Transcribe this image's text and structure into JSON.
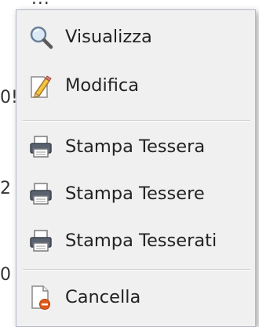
{
  "background": {
    "top_fragment": "¹...",
    "row_fragments": [
      "0!",
      "2",
      "0"
    ]
  },
  "context_menu": {
    "items": [
      {
        "label": "Visualizza",
        "icon": "magnifier-icon"
      },
      {
        "label": "Modifica",
        "icon": "pencil-edit-icon"
      },
      {
        "label": "Stampa Tessera",
        "icon": "printer-icon"
      },
      {
        "label": "Stampa Tessere",
        "icon": "printer-icon"
      },
      {
        "label": "Stampa Tesserati",
        "icon": "printer-icon"
      },
      {
        "label": "Cancella",
        "icon": "delete-document-icon"
      }
    ]
  },
  "colors": {
    "menu_bg": "#f0f0f0",
    "menu_border": "#b5b8c8",
    "text": "#222222",
    "delete_badge": "#e05a1a"
  }
}
